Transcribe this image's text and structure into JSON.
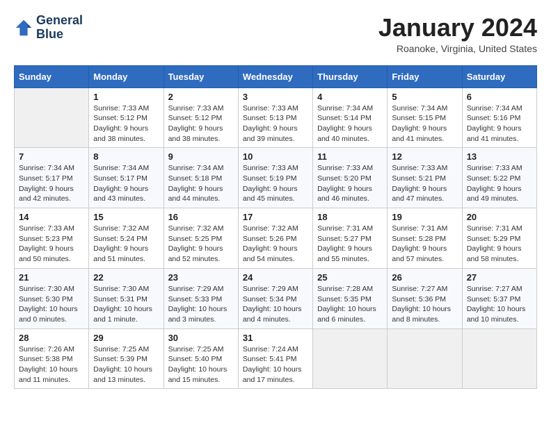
{
  "header": {
    "logo_line1": "General",
    "logo_line2": "Blue",
    "month_title": "January 2024",
    "location": "Roanoke, Virginia, United States"
  },
  "weekdays": [
    "Sunday",
    "Monday",
    "Tuesday",
    "Wednesday",
    "Thursday",
    "Friday",
    "Saturday"
  ],
  "weeks": [
    [
      {
        "day": "",
        "info": ""
      },
      {
        "day": "1",
        "info": "Sunrise: 7:33 AM\nSunset: 5:12 PM\nDaylight: 9 hours\nand 38 minutes."
      },
      {
        "day": "2",
        "info": "Sunrise: 7:33 AM\nSunset: 5:12 PM\nDaylight: 9 hours\nand 38 minutes."
      },
      {
        "day": "3",
        "info": "Sunrise: 7:33 AM\nSunset: 5:13 PM\nDaylight: 9 hours\nand 39 minutes."
      },
      {
        "day": "4",
        "info": "Sunrise: 7:34 AM\nSunset: 5:14 PM\nDaylight: 9 hours\nand 40 minutes."
      },
      {
        "day": "5",
        "info": "Sunrise: 7:34 AM\nSunset: 5:15 PM\nDaylight: 9 hours\nand 41 minutes."
      },
      {
        "day": "6",
        "info": "Sunrise: 7:34 AM\nSunset: 5:16 PM\nDaylight: 9 hours\nand 41 minutes."
      }
    ],
    [
      {
        "day": "7",
        "info": "Sunrise: 7:34 AM\nSunset: 5:17 PM\nDaylight: 9 hours\nand 42 minutes."
      },
      {
        "day": "8",
        "info": "Sunrise: 7:34 AM\nSunset: 5:17 PM\nDaylight: 9 hours\nand 43 minutes."
      },
      {
        "day": "9",
        "info": "Sunrise: 7:34 AM\nSunset: 5:18 PM\nDaylight: 9 hours\nand 44 minutes."
      },
      {
        "day": "10",
        "info": "Sunrise: 7:33 AM\nSunset: 5:19 PM\nDaylight: 9 hours\nand 45 minutes."
      },
      {
        "day": "11",
        "info": "Sunrise: 7:33 AM\nSunset: 5:20 PM\nDaylight: 9 hours\nand 46 minutes."
      },
      {
        "day": "12",
        "info": "Sunrise: 7:33 AM\nSunset: 5:21 PM\nDaylight: 9 hours\nand 47 minutes."
      },
      {
        "day": "13",
        "info": "Sunrise: 7:33 AM\nSunset: 5:22 PM\nDaylight: 9 hours\nand 49 minutes."
      }
    ],
    [
      {
        "day": "14",
        "info": "Sunrise: 7:33 AM\nSunset: 5:23 PM\nDaylight: 9 hours\nand 50 minutes."
      },
      {
        "day": "15",
        "info": "Sunrise: 7:32 AM\nSunset: 5:24 PM\nDaylight: 9 hours\nand 51 minutes."
      },
      {
        "day": "16",
        "info": "Sunrise: 7:32 AM\nSunset: 5:25 PM\nDaylight: 9 hours\nand 52 minutes."
      },
      {
        "day": "17",
        "info": "Sunrise: 7:32 AM\nSunset: 5:26 PM\nDaylight: 9 hours\nand 54 minutes."
      },
      {
        "day": "18",
        "info": "Sunrise: 7:31 AM\nSunset: 5:27 PM\nDaylight: 9 hours\nand 55 minutes."
      },
      {
        "day": "19",
        "info": "Sunrise: 7:31 AM\nSunset: 5:28 PM\nDaylight: 9 hours\nand 57 minutes."
      },
      {
        "day": "20",
        "info": "Sunrise: 7:31 AM\nSunset: 5:29 PM\nDaylight: 9 hours\nand 58 minutes."
      }
    ],
    [
      {
        "day": "21",
        "info": "Sunrise: 7:30 AM\nSunset: 5:30 PM\nDaylight: 10 hours\nand 0 minutes."
      },
      {
        "day": "22",
        "info": "Sunrise: 7:30 AM\nSunset: 5:31 PM\nDaylight: 10 hours\nand 1 minute."
      },
      {
        "day": "23",
        "info": "Sunrise: 7:29 AM\nSunset: 5:33 PM\nDaylight: 10 hours\nand 3 minutes."
      },
      {
        "day": "24",
        "info": "Sunrise: 7:29 AM\nSunset: 5:34 PM\nDaylight: 10 hours\nand 4 minutes."
      },
      {
        "day": "25",
        "info": "Sunrise: 7:28 AM\nSunset: 5:35 PM\nDaylight: 10 hours\nand 6 minutes."
      },
      {
        "day": "26",
        "info": "Sunrise: 7:27 AM\nSunset: 5:36 PM\nDaylight: 10 hours\nand 8 minutes."
      },
      {
        "day": "27",
        "info": "Sunrise: 7:27 AM\nSunset: 5:37 PM\nDaylight: 10 hours\nand 10 minutes."
      }
    ],
    [
      {
        "day": "28",
        "info": "Sunrise: 7:26 AM\nSunset: 5:38 PM\nDaylight: 10 hours\nand 11 minutes."
      },
      {
        "day": "29",
        "info": "Sunrise: 7:25 AM\nSunset: 5:39 PM\nDaylight: 10 hours\nand 13 minutes."
      },
      {
        "day": "30",
        "info": "Sunrise: 7:25 AM\nSunset: 5:40 PM\nDaylight: 10 hours\nand 15 minutes."
      },
      {
        "day": "31",
        "info": "Sunrise: 7:24 AM\nSunset: 5:41 PM\nDaylight: 10 hours\nand 17 minutes."
      },
      {
        "day": "",
        "info": ""
      },
      {
        "day": "",
        "info": ""
      },
      {
        "day": "",
        "info": ""
      }
    ]
  ]
}
